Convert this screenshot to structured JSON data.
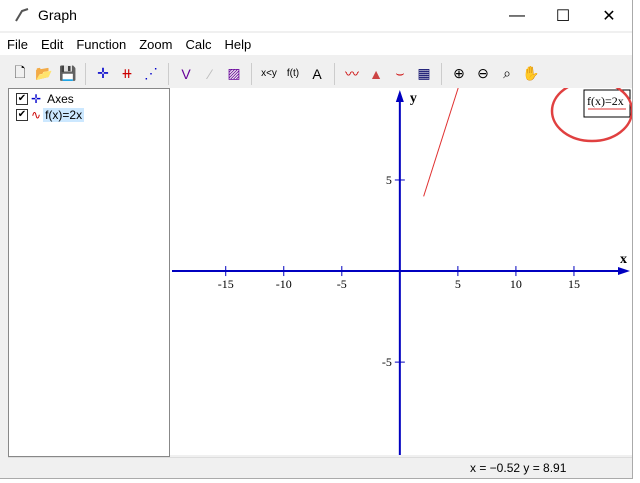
{
  "window": {
    "title": "Graph",
    "minimize": "—",
    "maximize": "☐",
    "close": "✕"
  },
  "menu": [
    "File",
    "Edit",
    "Function",
    "Zoom",
    "Calc",
    "Help"
  ],
  "toolbar": [
    {
      "name": "new-icon",
      "glyph": "🗋",
      "color": "#000"
    },
    {
      "name": "open-icon",
      "glyph": "📂",
      "color": "#a80"
    },
    {
      "name": "save-icon",
      "glyph": "💾",
      "color": "#000"
    },
    {
      "sep": true
    },
    {
      "name": "axes-icon",
      "glyph": "✛",
      "color": "#00c"
    },
    {
      "name": "insert-function-icon",
      "glyph": "⧺",
      "color": "#c00"
    },
    {
      "name": "point-series-icon",
      "glyph": "⋰",
      "color": "#00c"
    },
    {
      "sep": true
    },
    {
      "name": "tangent-icon",
      "glyph": "V",
      "color": "#609"
    },
    {
      "name": "shade-icon",
      "glyph": "⁄",
      "color": "#bbb"
    },
    {
      "name": "relation-icon",
      "glyph": "▨",
      "color": "#609"
    },
    {
      "sep": true
    },
    {
      "name": "inequality-icon",
      "glyph": "x<y",
      "color": "#000"
    },
    {
      "name": "custom-function-icon",
      "glyph": "f(t)",
      "color": "#000"
    },
    {
      "name": "label-icon",
      "glyph": "A",
      "color": "#000"
    },
    {
      "sep": true
    },
    {
      "name": "trendline-icon",
      "glyph": "〰",
      "color": "#c00"
    },
    {
      "name": "area-icon",
      "glyph": "▲",
      "color": "#c44"
    },
    {
      "name": "evaluate-icon",
      "glyph": "⌣",
      "color": "#c00"
    },
    {
      "name": "table-icon",
      "glyph": "▦",
      "color": "#006"
    },
    {
      "sep": true
    },
    {
      "name": "zoom-in-icon",
      "glyph": "⊕",
      "color": "#000"
    },
    {
      "name": "zoom-out-icon",
      "glyph": "⊖",
      "color": "#000"
    },
    {
      "name": "zoom-window-icon",
      "glyph": "⌕",
      "color": "#000"
    },
    {
      "name": "pan-hand-icon",
      "glyph": "✋",
      "color": "#000"
    }
  ],
  "tree": [
    {
      "label": "Axes",
      "checked": "✔"
    },
    {
      "label": "f(x)=2x",
      "checked": "✔"
    }
  ],
  "plot": {
    "x_label": "x",
    "y_label": "y",
    "x_ticks": [
      -15,
      -10,
      -5,
      5,
      10,
      15
    ],
    "y_ticks": [
      -5,
      5
    ],
    "xmin": -19.8,
    "xmax": 20,
    "ymin": -10.1,
    "ymax": 10.05,
    "legend": "f(x)=2x",
    "function_color": "#e03030",
    "axis_color": "#0000c0",
    "xstart": 2.05
  },
  "status": {
    "coords": "x = −0.52   y = 8.91"
  }
}
